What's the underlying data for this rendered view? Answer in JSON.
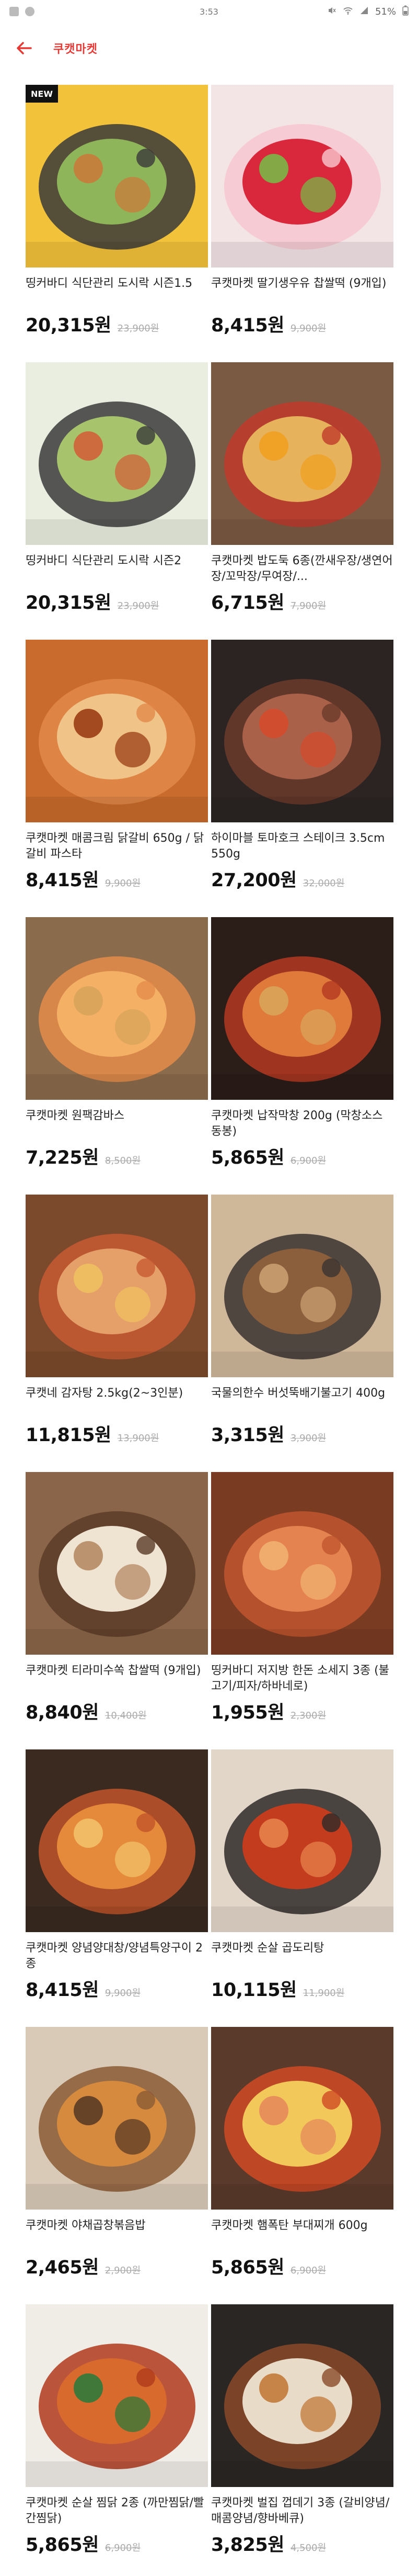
{
  "status": {
    "time_text": "3:53",
    "battery": "51%"
  },
  "header": {
    "title": "쿠캣마켓"
  },
  "products": [
    {
      "name": "띵커바디 식단관리 도시락 시즌1.5",
      "price": "20,315원",
      "original": "23,900원",
      "badge": "NEW",
      "img": {
        "bg": "#f2c23a",
        "accent": "#3a3a3a",
        "dish": "#8fb55a",
        "alt": "#c97b3b"
      }
    },
    {
      "name": "쿠캣마켓 딸기생우유 찹쌀떡 (9개입)",
      "price": "8,415원",
      "original": "9,900원",
      "img": {
        "bg": "#f3e4e6",
        "accent": "#f7c7cf",
        "dish": "#d9283b",
        "alt": "#7ab648"
      }
    },
    {
      "name": "띵커바디 식단관리 도시락 시즌2",
      "price": "20,315원",
      "original": "23,900원",
      "img": {
        "bg": "#e9eee0",
        "accent": "#3b3b3b",
        "dish": "#a7c46c",
        "alt": "#d2603a"
      }
    },
    {
      "name": "쿠캣마켓 밥도둑 6종(깐새우장/생연어장/꼬막장/무여장/...",
      "price": "6,715원",
      "original": "7,900원",
      "img": {
        "bg": "#7a5a43",
        "accent": "#c0392b",
        "dish": "#e6b25c",
        "alt": "#f0a020"
      }
    },
    {
      "name": "쿠캣마켓 매콤크림 닭갈비 650g / 닭갈비 파스타",
      "price": "8,415원",
      "original": "9,900원",
      "img": {
        "bg": "#c86b2c",
        "accent": "#e2894a",
        "dish": "#f0c389",
        "alt": "#9a3d16"
      }
    },
    {
      "name": "하이마블 토마호크 스테이크 3.5cm 550g",
      "price": "27,200원",
      "original": "32,000원",
      "img": {
        "bg": "#2b2422",
        "accent": "#6b3b2a",
        "dish": "#a9614a",
        "alt": "#d44b2c"
      }
    },
    {
      "name": "쿠캣마켓 원팩감바스",
      "price": "7,225원",
      "original": "8,500원",
      "img": {
        "bg": "#8a6b4c",
        "accent": "#e58c4a",
        "dish": "#f4b064",
        "alt": "#d8a45a"
      }
    },
    {
      "name": "쿠캣마켓 납작막창 200g (막창소스 동봉)",
      "price": "5,865원",
      "original": "6,900원",
      "img": {
        "bg": "#2b1d18",
        "accent": "#b43a22",
        "dish": "#e07a3a",
        "alt": "#d9a45a"
      }
    },
    {
      "name": "쿠캣네 감자탕 2.5kg(2~3인분)",
      "price": "11,815원",
      "original": "13,900원",
      "img": {
        "bg": "#7b4a2c",
        "accent": "#c85a32",
        "dish": "#e5a06a",
        "alt": "#f0c060"
      }
    },
    {
      "name": "국물의한수 버섯뚝배기불고기 400g",
      "price": "3,315원",
      "original": "3,900원",
      "img": {
        "bg": "#cfb79a",
        "accent": "#3a3330",
        "dish": "#8b5e3c",
        "alt": "#c9a070"
      }
    },
    {
      "name": "쿠캣마켓 티라미수쏙 찹쌀떡 (9개입)",
      "price": "8,840원",
      "original": "10,400원",
      "img": {
        "bg": "#8a6549",
        "accent": "#5a3c28",
        "dish": "#efe4d2",
        "alt": "#b58a64"
      }
    },
    {
      "name": "띵커바디 저지방 한돈 소세지 3종 (불고기/피자/하바네로)",
      "price": "1,955원",
      "original": "2,300원",
      "img": {
        "bg": "#7a3b23",
        "accent": "#c0562e",
        "dish": "#e58350",
        "alt": "#f0b070"
      }
    },
    {
      "name": "쿠캣마켓 양념양대창/양념특양구이 2종",
      "price": "8,415원",
      "original": "9,900원",
      "img": {
        "bg": "#3a2a20",
        "accent": "#c0542a",
        "dish": "#e58a3a",
        "alt": "#f2c06a"
      }
    },
    {
      "name": "쿠캣마켓 순살 곱도리탕",
      "price": "10,115원",
      "original": "11,900원",
      "img": {
        "bg": "#e2d6c8",
        "accent": "#2e2a28",
        "dish": "#c33c1e",
        "alt": "#e5824a"
      }
    },
    {
      "name": "쿠캣마켓 야채곱창볶음밥",
      "price": "2,465원",
      "original": "2,900원",
      "img": {
        "bg": "#d9cab7",
        "accent": "#8a5a34",
        "dish": "#d68a3e",
        "alt": "#5a3a24"
      }
    },
    {
      "name": "쿠캣마켓 햄폭탄 부대찌개 600g",
      "price": "5,865원",
      "original": "6,900원",
      "img": {
        "bg": "#5a3a2a",
        "accent": "#d04a24",
        "dish": "#f3c85a",
        "alt": "#e58a5a"
      }
    },
    {
      "name": "쿠캣마켓 순살 찜닭 2종 (까만찜닭/빨간찜닭)",
      "price": "5,865원",
      "original": "6,900원",
      "img": {
        "bg": "#f0ece6",
        "accent": "#b03a1c",
        "dish": "#d86a2e",
        "alt": "#2f7a3a"
      }
    },
    {
      "name": "쿠캣마켓 벌집 껍데기 3종 (갈비양념/매콤양념/향바베큐)",
      "price": "3,825원",
      "original": "4,500원",
      "img": {
        "bg": "#2a2624",
        "accent": "#8a4a2a",
        "dish": "#e8dcc8",
        "alt": "#c27a3a"
      }
    }
  ]
}
